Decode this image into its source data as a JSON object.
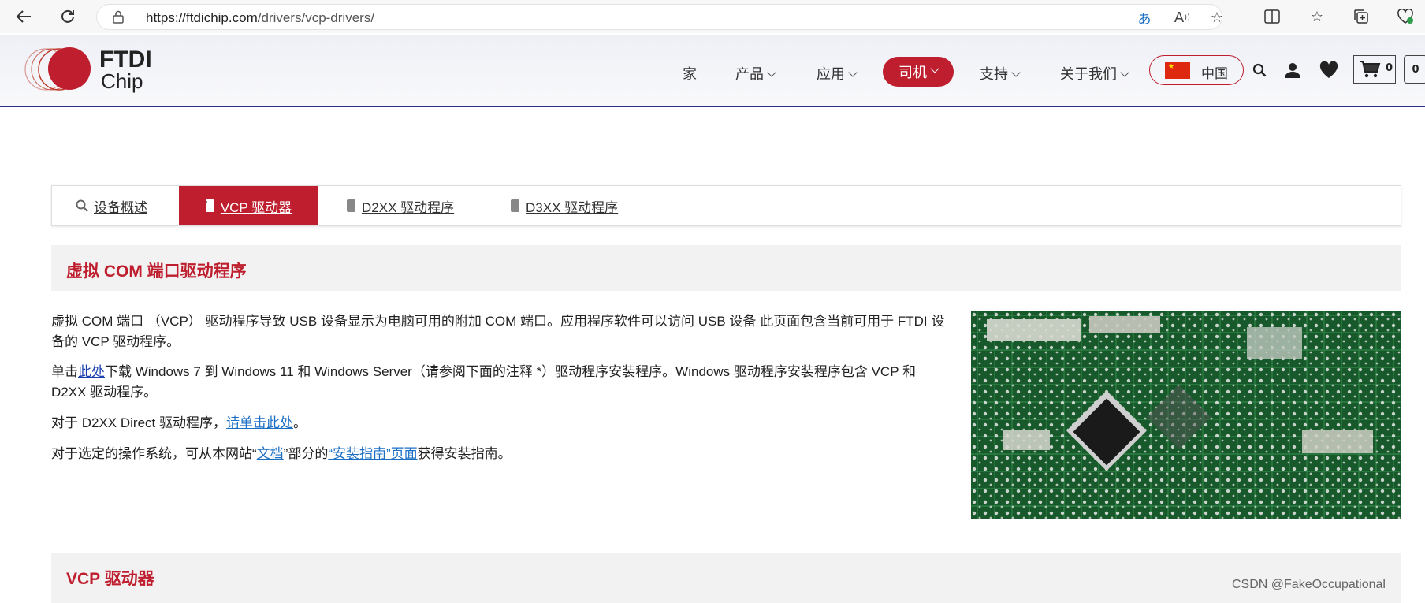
{
  "browser": {
    "url_host": "https://ftdichip.com",
    "url_path": "/drivers/vcp-drivers/",
    "icons": [
      "back-icon",
      "reload-icon",
      "lock-icon",
      "translate-icon",
      "read-aloud-icon",
      "favorite-star-icon",
      "split-screen-icon",
      "favorites-icon",
      "collections-icon",
      "browser-essentials-icon"
    ]
  },
  "header": {
    "logo_text_1": "FTDI",
    "logo_text_2": "Chip",
    "nav": {
      "home": "家",
      "products": "产品",
      "applications": "应用",
      "drivers": "司机",
      "support": "支持",
      "about": "关于我们"
    },
    "country": "中国",
    "cart_count": "0",
    "cart2_count": "0"
  },
  "tabs": {
    "overview": "设备概述",
    "vcp": "VCP 驱动器",
    "d2xx": "D2XX 驱动程序",
    "d3xx": "D3XX 驱动程序"
  },
  "section1": {
    "title": "虚拟 COM 端口驱动程序"
  },
  "para1": "虚拟 COM 端口 （VCP） 驱动程序导致 USB 设备显示为电脑可用的附加 COM 端口。应用程序软件可以访问 USB 设备 此页面包含当前可用于 FTDI 设备的 VCP 驱动程序。",
  "para2": {
    "prefix": "单击",
    "link": "此处",
    "suffix": "下载 Windows 7 到 Windows 11 和 Windows Server（请参阅下面的注释 *）驱动程序安装程序。Windows 驱动程序安装程序包含 VCP 和 D2XX 驱动程序。"
  },
  "para3": {
    "prefix": "对于 D2XX Direct 驱动程序，",
    "link": "请单击此处",
    "suffix": "。"
  },
  "para4": {
    "prefix": "对于选定的操作系统，可从本网站“",
    "link1": "文档",
    "middle": "”部分的",
    "link2": "“安装指南”页面",
    "suffix": "获得安装指南。"
  },
  "section2": {
    "title": "VCP 驱动器"
  },
  "watermark": "CSDN @FakeOccupational"
}
